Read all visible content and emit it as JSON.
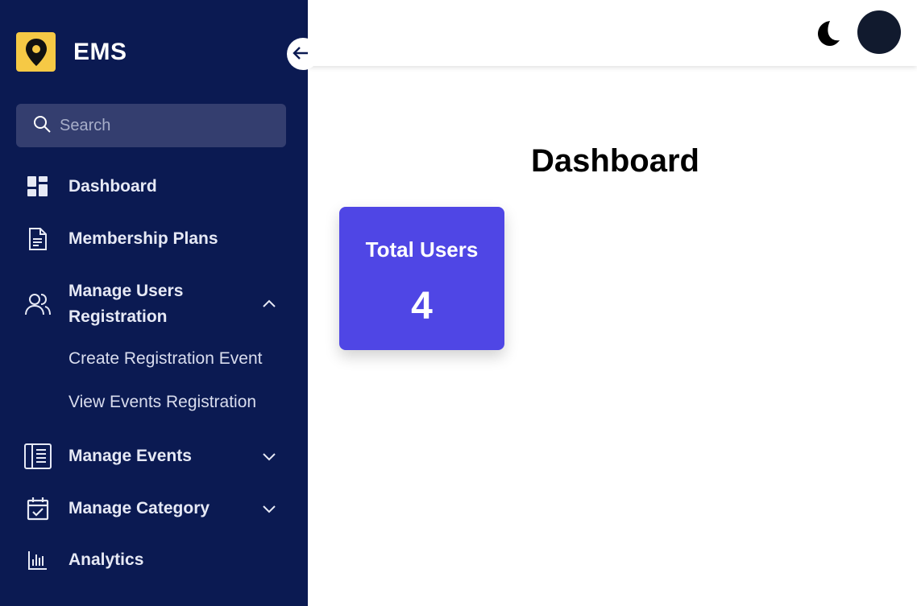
{
  "brand": {
    "name": "EMS",
    "logo_icon": "map-pin-icon",
    "logo_color": "#f6c945"
  },
  "sidebar": {
    "background": "#0b1a52",
    "collapse_icon": "arrow-left-icon",
    "search": {
      "placeholder": "Search",
      "value": ""
    },
    "items": [
      {
        "label": "Dashboard",
        "icon": "dashboard-icon"
      },
      {
        "label": "Membership Plans",
        "icon": "document-icon"
      },
      {
        "label": "Manage Users Registration",
        "icon": "users-icon",
        "expanded": true,
        "children": [
          {
            "label": "Create Registration Event"
          },
          {
            "label": "View Events Registration"
          }
        ]
      },
      {
        "label": "Manage Events",
        "icon": "list-icon",
        "expanded": false
      },
      {
        "label": "Manage Category",
        "icon": "calendar-check-icon",
        "expanded": false
      },
      {
        "label": "Analytics",
        "icon": "bar-chart-icon"
      }
    ]
  },
  "topbar": {
    "theme_icon": "moon-icon",
    "avatar_color": "#111a2e"
  },
  "main": {
    "title": "Dashboard",
    "cards": [
      {
        "label": "Total Users",
        "value": "4",
        "color": "#4f46e5"
      }
    ]
  }
}
